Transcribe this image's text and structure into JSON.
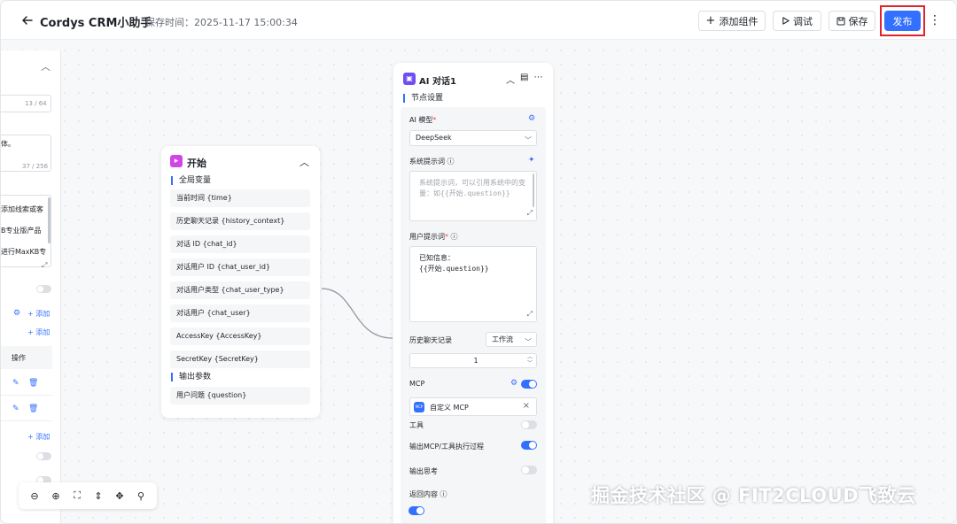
{
  "header": {
    "title": "Cordys CRM小助手",
    "saved_time": "保存时间：2025-11-17 15:00:34",
    "add_component_label": "添加组件",
    "debug_label": "调试",
    "save_label": "保存",
    "publish_label": "发布",
    "highlight_color": "#e0232e",
    "accent_color": "#3370ff"
  },
  "left_panel": {
    "count1": "13 / 64",
    "text1": "体。",
    "count2": "37 / 256",
    "list_items": [
      "添加线索或客",
      "B专业版产品",
      "进行MaxKB专"
    ],
    "add_label": "添加",
    "add_label2": "添加",
    "add_label3": "添加",
    "ops_header": "操作"
  },
  "start_node": {
    "title": "开始",
    "global_vars_label": "全局变量",
    "global_vars": [
      "当前时间 {time}",
      "历史聊天记录 {history_context}",
      "对话 ID {chat_id}",
      "对话用户 ID {chat_user_id}",
      "对话用户类型 {chat_user_type}",
      "对话用户 {chat_user}",
      "AccessKey {AccessKey}",
      "SecretKey {SecretKey}"
    ],
    "output_label": "输出参数",
    "output_vars": [
      "用户问题 {question}"
    ]
  },
  "ai_node": {
    "title": "AI 对话1",
    "settings_label": "节点设置",
    "model_label": "AI 模型",
    "model_value": "DeepSeek",
    "system_prompt_label": "系统提示词",
    "system_prompt_placeholder": "系统提示词，可以引用系统中的变量：如{{开始.question}}",
    "system_prompt_line1": "系统提示词，可以引用系统中的变",
    "system_prompt_line2": "量：如{{开始.question}}",
    "user_prompt_label": "用户提示词",
    "user_prompt_line1": "已知信息：",
    "user_prompt_line2": "{{开始.question}}",
    "history_label": "历史聊天记录",
    "history_mode": "工作流",
    "history_count": "1",
    "mcp_label": "MCP",
    "mcp_item": "自定义 MCP",
    "mcp_badge": "MCP",
    "mcp_enabled": true,
    "tools_label": "工具",
    "tools_enabled": false,
    "output_mcp_label": "输出MCP/工具执行过程",
    "output_mcp_enabled": true,
    "output_thinking_label": "输出思考",
    "output_thinking_enabled": false,
    "return_content_label": "返回内容",
    "return_content_enabled": true
  },
  "watermark": "掘金技术社区 @ FIT2CLOUD飞致云"
}
